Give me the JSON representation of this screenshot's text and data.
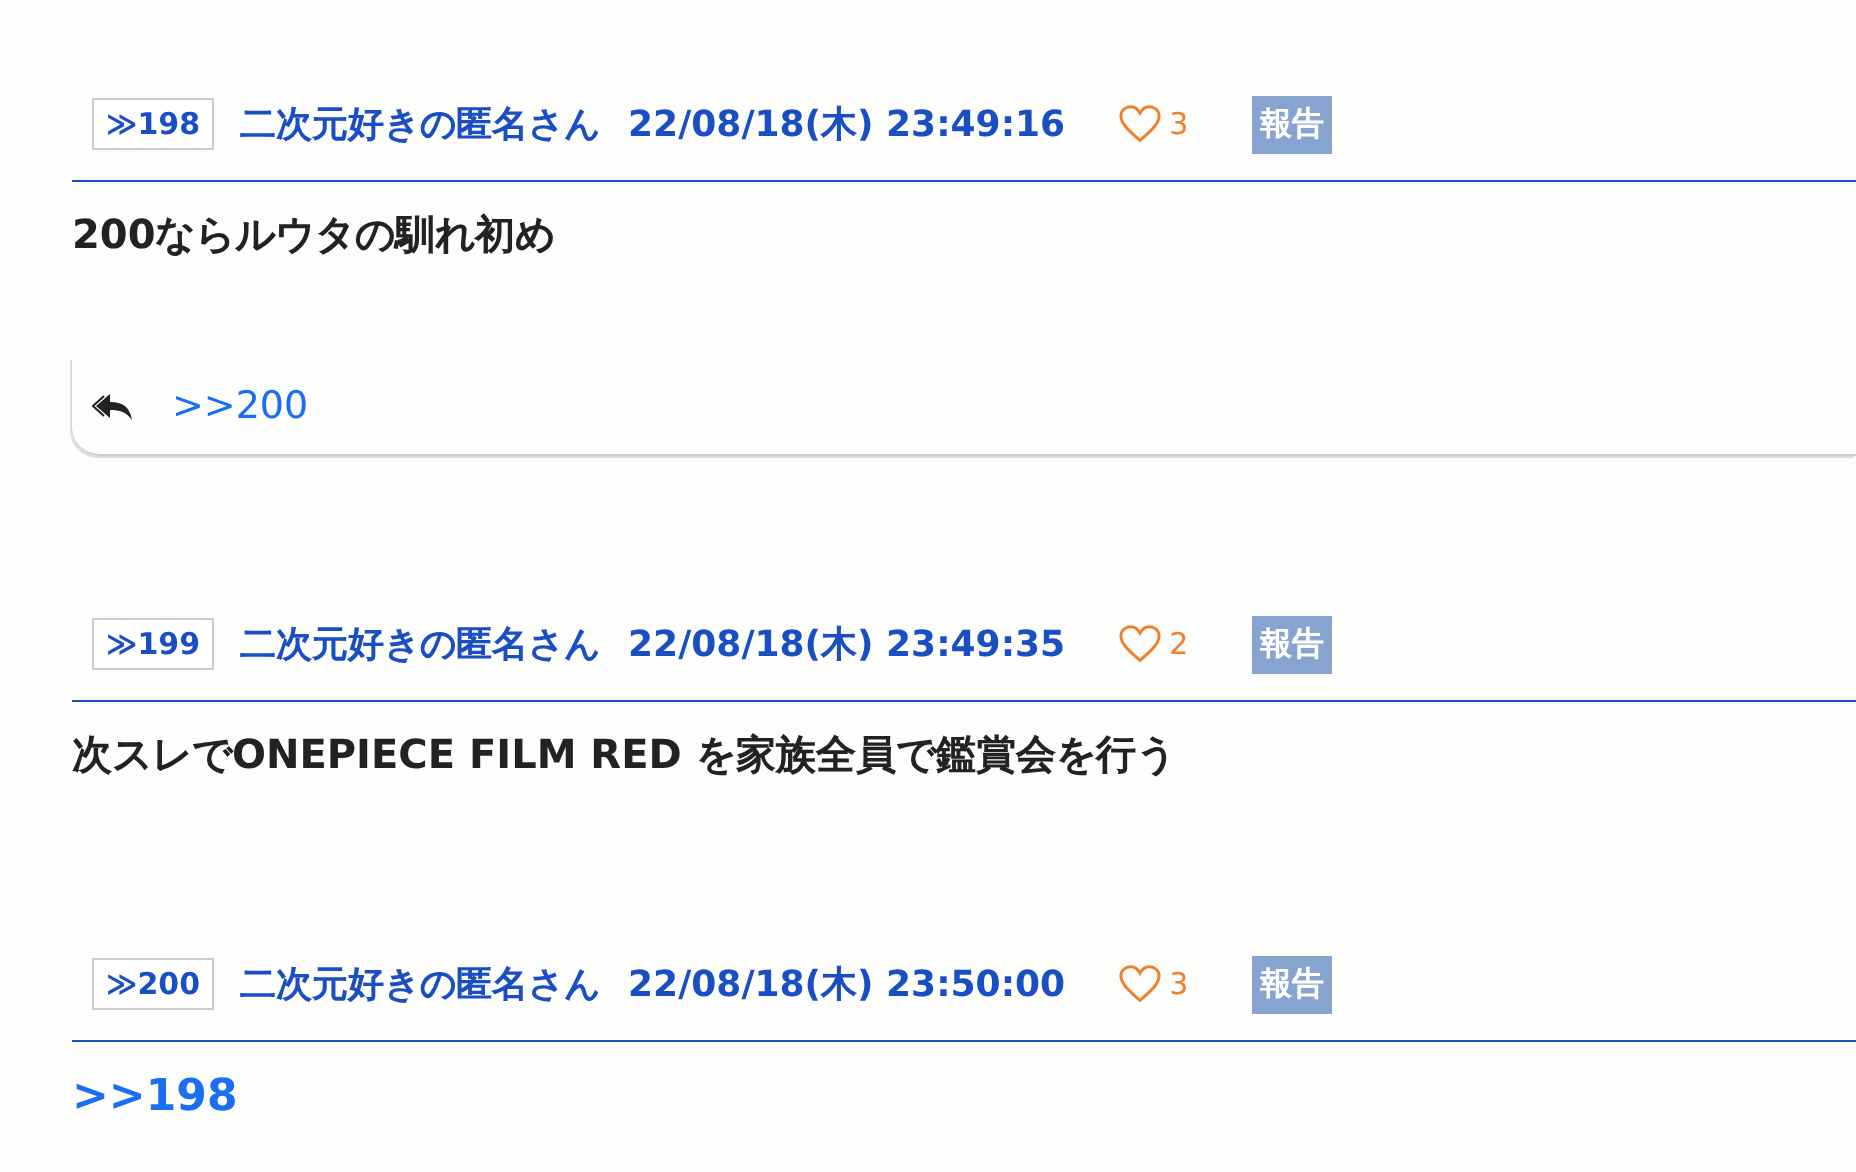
{
  "posts": [
    {
      "number": "≫198",
      "name": "二次元好きの匿名さん",
      "date": "22/08/18(木) 23:49:16",
      "likes": "3",
      "report": "報告",
      "body": {
        "kind": "text",
        "text": "200ならルウタの馴れ初め"
      },
      "replies": [
        ">>200"
      ]
    },
    {
      "number": "≫199",
      "name": "二次元好きの匿名さん",
      "date": "22/08/18(木) 23:49:35",
      "likes": "2",
      "report": "報告",
      "body": {
        "kind": "text",
        "text": "次スレでONEPIECE FILM RED を家族全員で鑑賞会を行う"
      }
    },
    {
      "number": "≫200",
      "name": "二次元好きの匿名さん",
      "date": "22/08/18(木) 23:50:00",
      "likes": "3",
      "report": "報告",
      "body": {
        "kind": "anchor",
        "text": ">>198"
      }
    }
  ]
}
